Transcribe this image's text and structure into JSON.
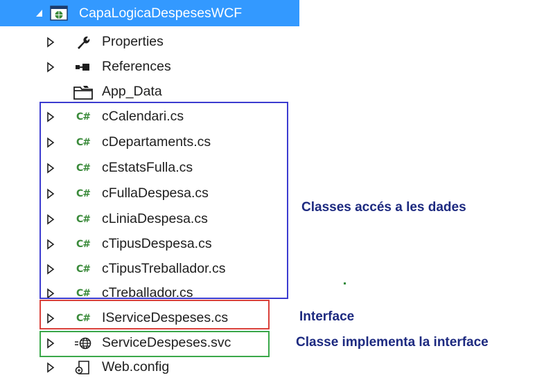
{
  "tree": {
    "root": {
      "label": "CapaLogicaDespesesWCF",
      "icon": "web-project-icon",
      "expanded": true
    },
    "items": [
      {
        "label": "Properties",
        "icon": "wrench-icon",
        "has_arrow": true
      },
      {
        "label": "References",
        "icon": "references-icon",
        "has_arrow": true
      },
      {
        "label": "App_Data",
        "icon": "folder-icon",
        "has_arrow": false
      },
      {
        "label": "cCalendari.cs",
        "icon": "csharp-file-icon",
        "has_arrow": true
      },
      {
        "label": "cDepartaments.cs",
        "icon": "csharp-file-icon",
        "has_arrow": true
      },
      {
        "label": "cEstatsFulla.cs",
        "icon": "csharp-file-icon",
        "has_arrow": true
      },
      {
        "label": "cFullaDespesa.cs",
        "icon": "csharp-file-icon",
        "has_arrow": true
      },
      {
        "label": "cLiniaDespesa.cs",
        "icon": "csharp-file-icon",
        "has_arrow": true
      },
      {
        "label": "cTipusDespesa.cs",
        "icon": "csharp-file-icon",
        "has_arrow": true
      },
      {
        "label": "cTipusTreballador.cs",
        "icon": "csharp-file-icon",
        "has_arrow": true
      },
      {
        "label": "cTreballador.cs",
        "icon": "csharp-file-icon",
        "has_arrow": true
      },
      {
        "label": "IServiceDespeses.cs",
        "icon": "csharp-file-icon",
        "has_arrow": true
      },
      {
        "label": "ServiceDespeses.svc",
        "icon": "web-service-icon",
        "has_arrow": true
      },
      {
        "label": "Web.config",
        "icon": "config-file-icon",
        "has_arrow": true
      }
    ],
    "cs_badge": "C#"
  },
  "annotations": {
    "data_classes": "Classes accés a les dades",
    "interface": "Interface",
    "implements": "Classe implementa la interface"
  },
  "colors": {
    "selection": "#3399ff",
    "blue_box": "#3b3bd0",
    "red_box": "#d9403a",
    "green_box": "#3aa84a",
    "annotation_text": "#1d2a80",
    "csharp_icon": "#3a8a3a"
  }
}
